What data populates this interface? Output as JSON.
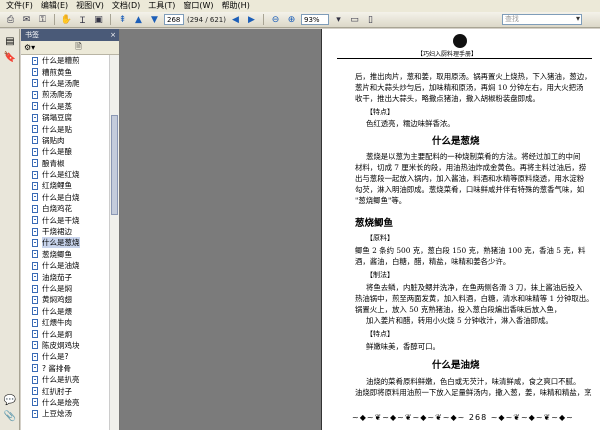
{
  "menu": [
    "文件(F)",
    "编辑(E)",
    "视图(V)",
    "文档(D)",
    "工具(T)",
    "窗口(W)",
    "帮助(H)"
  ],
  "toolbar": {
    "page_current": "268",
    "page_total": "(294 / 621)",
    "zoom": "93%",
    "search_placeholder": "查找"
  },
  "panel": {
    "title": "书签"
  },
  "bookmarks": [
    "什么是糟煎",
    "糟煎黄鱼",
    "什么是汤爬",
    "煎汤爬汤",
    "什么是蒸",
    "锅塌豆腐",
    "什么是贴",
    "锅贴肉",
    "什么是酿",
    "酿青椒",
    "什么是红烧",
    "红烧鲤鱼",
    "什么是白烧",
    "白烧鸡花",
    "什么是干烧",
    "干烧裙边",
    "什么是葱烧",
    "葱烧鲫鱼",
    "什么是油烧",
    "油烧茄子",
    "什么是焖",
    "黄焖鸡翅",
    "什么是煨",
    "红煨牛肉",
    "什么是炯",
    "陈皮炯鸡块",
    "什么是?",
    "? 酱排骨",
    "什么是扒亮",
    "红扒肘子",
    "什么是烩亮",
    "上豆烩汤"
  ],
  "document": {
    "header": "【巧妇入厨料理手册】",
    "lines": [
      "后，推出肉片，葱和姜，取用原汤。锅再置火上烧热，下入猪油，葱边，",
      "葱片和大蒜头炒勻后，加味精和原汤，再焖 10 分钟左右，用大火把汤",
      "收干，推出大蒜头，略撒点猪油，撒入胡椒粉装盘即成。"
    ],
    "feature_label_1": "【特点】",
    "feature_text_1": "色红透亮，糯边味鲜香浓。",
    "section_title_1": "什么是葱烧",
    "intro": [
      "葱烧是以葱为主要配料的一种烧制菜肴的方法。将经过加工的中间",
      "材料，切成 7 厘米长的段，用油热油炸成金黄色。再将主料过油后，捞",
      "出与葱段一起放入锅内，加入酱油，料酒和水精等原料烧透，用水淀粉",
      "勾芡，淋入明油即成。葱烧菜肴，口味鲜咸并伴有特殊的葱香气味，如",
      "\"葱烧鲫鱼\"等。"
    ],
    "section_title_2": "葱烧鲫鱼",
    "ingredients_label": "【原料】",
    "ingredients": [
      "鲫鱼 2 条约 500 克，葱白段 150 克，熟猪油 100 克，香油 5 克，料",
      "酒，酱油，白糖，醋，精盐，味精和姜各少许。"
    ],
    "method_label": "【制法】",
    "method": [
      "将鱼去鳞，内脏及鳃并洗净，在鱼两侧各滑 3 刀，抹上酱油后投入",
      "热油锅中，煎至两面发黄，加入料酒，白糖，清水和味精等 1 分钟取出。",
      "锅置火上，放入 50 克熟猪油，投入葱白段煸出香味后放入鱼，",
      "加入姜片和醋，转用小火烧 5 分钟收汁，淋入香油即成。"
    ],
    "feature_label_2": "【特点】",
    "feature_text_2": "鲜嫩味美，香醇可口。",
    "section_title_3": "什么是油烧",
    "closing": [
      "油烧的菜肴原料鲜嫩，色白或无芡汁，味清鲜咸，食之爽口不腻。",
      "油烧即将原料用油煎一下放入足量鲜汤内，撒入葱，姜，味精和精盐，烹"
    ],
    "page_number": "268"
  }
}
